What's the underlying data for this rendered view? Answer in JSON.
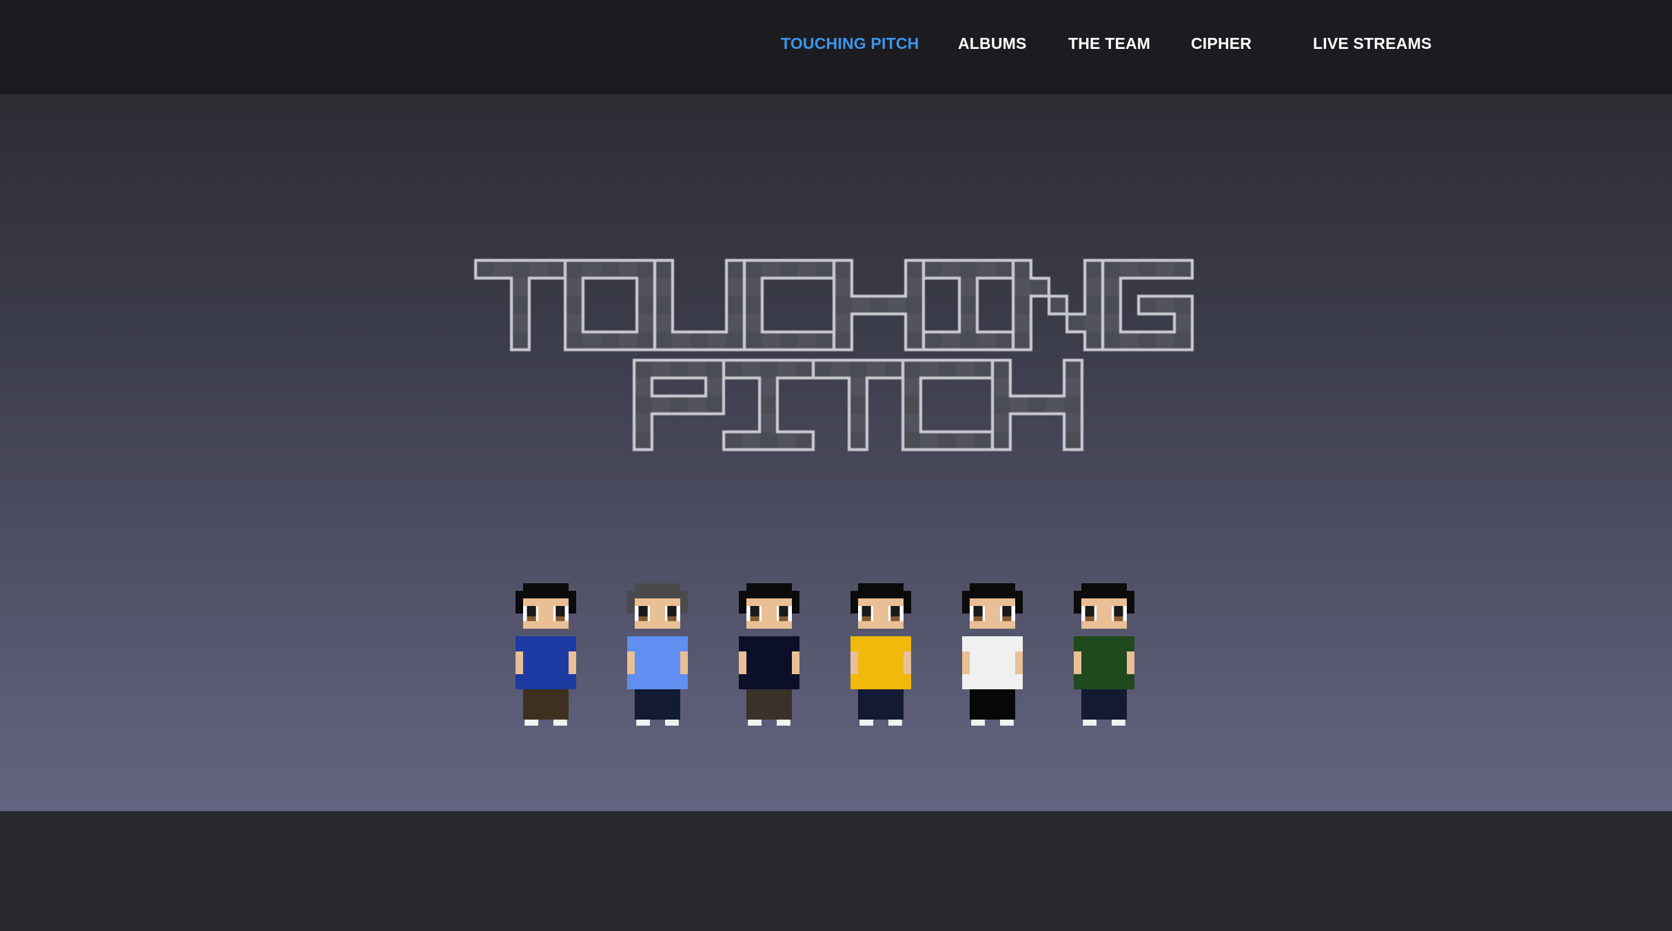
{
  "nav": {
    "items": [
      {
        "label": "TOUCHING PITCH",
        "active": true
      },
      {
        "label": "ALBUMS",
        "active": false
      },
      {
        "label": "THE TEAM",
        "active": false
      },
      {
        "label": "CIPHER",
        "active": false
      },
      {
        "label": "LIVE STREAMS",
        "active": false
      }
    ]
  },
  "hero": {
    "logo_line1": "TOUCHING",
    "logo_line2": "PITCH",
    "characters": [
      {
        "name": "member-1",
        "shirt": "#1d3aa3",
        "pants": "#3f2f1e",
        "hair": "#0b0b0b"
      },
      {
        "name": "member-2",
        "shirt": "#5f8ff0",
        "pants": "#131b33",
        "hair": "#4a4a4a"
      },
      {
        "name": "member-3",
        "shirt": "#0c0f2a",
        "pants": "#3a3229",
        "hair": "#0b0b0b"
      },
      {
        "name": "member-4",
        "shirt": "#f0b90b",
        "pants": "#141a33",
        "hair": "#0b0b0b"
      },
      {
        "name": "member-5",
        "shirt": "#f0f0f0",
        "pants": "#070707",
        "hair": "#0b0b0b"
      },
      {
        "name": "member-6",
        "shirt": "#1f4a1d",
        "pants": "#141a33",
        "hair": "#0b0b0b"
      }
    ]
  },
  "colors": {
    "accent": "#3e95ec",
    "topbar": "#1c1c20",
    "footer": "#27282d",
    "skin": "#e9bf95"
  }
}
